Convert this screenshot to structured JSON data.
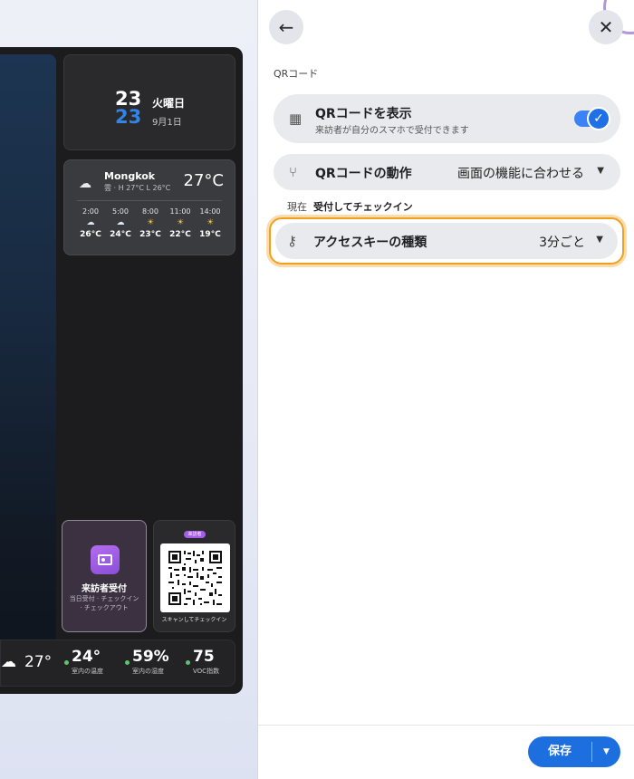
{
  "preview": {
    "clock": {
      "hour": "23",
      "minute": "23",
      "weekday": "火曜日",
      "date": "9月1日"
    },
    "weather": {
      "city": "Mongkok",
      "condition": "雲 · H 27°C L 26°C",
      "current": "27°C",
      "icon": "cloud-icon",
      "forecast": [
        {
          "time": "2:00",
          "icon": "cloud-icon",
          "temp": "26°C"
        },
        {
          "time": "5:00",
          "icon": "cloud-icon",
          "temp": "24°C"
        },
        {
          "time": "8:00",
          "icon": "partly-sunny-icon",
          "temp": "23°C"
        },
        {
          "time": "11:00",
          "icon": "partly-sunny-icon",
          "temp": "22°C"
        },
        {
          "time": "14:00",
          "icon": "partly-sunny-icon",
          "temp": "19°C"
        }
      ]
    },
    "visitor": {
      "title": "来訪者受付",
      "subtitle": "当日受付 · チェックイン · チェックアウト"
    },
    "qr_card": {
      "badge": "来訪者",
      "caption": "スキャンしてチェックイン"
    },
    "stats": {
      "outdoor_temp": "27°",
      "items": [
        {
          "value": "24°",
          "label": "室内の温度"
        },
        {
          "value": "59%",
          "label": "室内の湿度"
        },
        {
          "value": "75",
          "label": "VOC指数"
        }
      ]
    }
  },
  "panel": {
    "section": "QRコード",
    "show_qr": {
      "title": "QRコードを表示",
      "subtitle": "来訪者が自分のスマホで受付できます",
      "enabled": true
    },
    "qr_action": {
      "title": "QRコードの動作",
      "value": "画面の機能に合わせる"
    },
    "current_label": "現在",
    "current_value": "受付してチェックイン",
    "access_key": {
      "title": "アクセスキーの種類",
      "value": "3分ごと"
    },
    "save_label": "保存"
  },
  "colors": {
    "accent": "#1d6fe0",
    "highlight": "#f0a020",
    "clock_minute": "#2f86e8"
  }
}
